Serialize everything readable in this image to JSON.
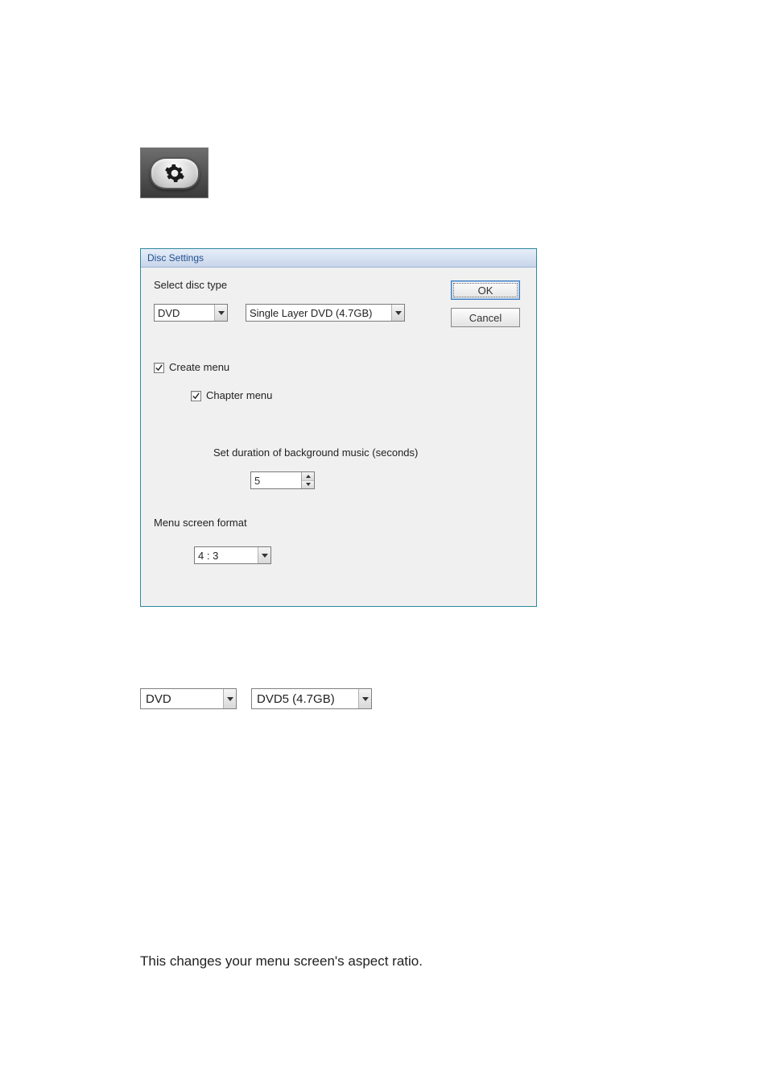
{
  "gear": {
    "icon_name": "gear-icon"
  },
  "dialog": {
    "title": "Disc Settings",
    "select_disc_label": "Select disc type",
    "disc_type_value": "DVD",
    "disc_layer_value": "Single Layer DVD (4.7GB)",
    "ok_label": "OK",
    "cancel_label": "Cancel",
    "create_menu_label": "Create menu",
    "create_menu_checked": true,
    "chapter_menu_label": "Chapter menu",
    "chapter_menu_checked": true,
    "bgm_duration_label": "Set duration of background music (seconds)",
    "bgm_duration_value": "5",
    "menu_format_label": "Menu screen format",
    "menu_format_value": "4 : 3"
  },
  "standalone": {
    "disc_type_value": "DVD",
    "disc_layer_value": "DVD5 (4.7GB)"
  },
  "caption": "This changes your menu screen's aspect ratio."
}
